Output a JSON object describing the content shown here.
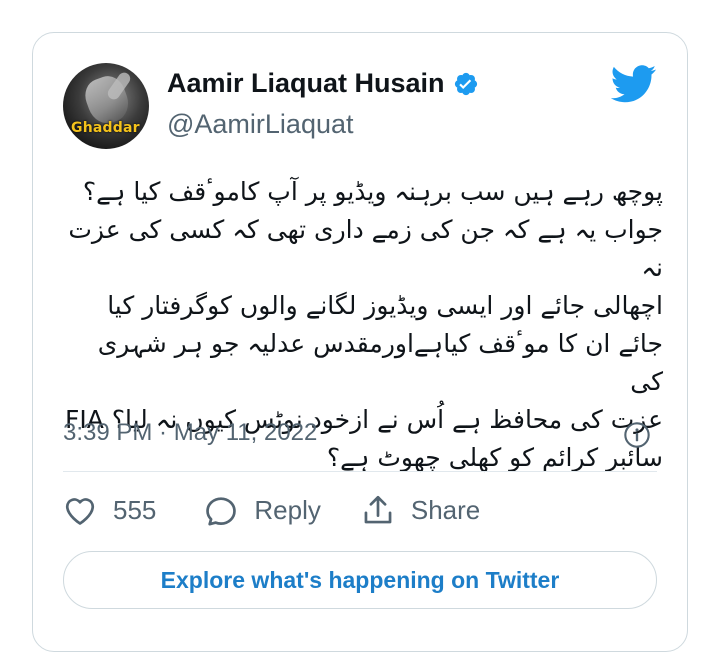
{
  "author": {
    "display_name": "Aamir Liaquat Husain",
    "handle": "@AamirLiaquat",
    "avatar_text": "Ghaddar",
    "verified": true
  },
  "tweet": {
    "text": "پوچھ رہے ہیں سب برہنہ ویڈیو پر آپ کاموٴقف کیا ہے؟\nجواب یہ ہے کہ جن کی زمے داری تھی کہ کسی کی عزت نہ\nاچھالی جائے اور ایسی ویڈیوز لگانے والوں کوگرفتار کیا\nجائے ان کا موٴقف کیاہےاورمقدس عدلیہ جو ہر شہری کی\nعزت کی محافظ ہے اُس نے ازخود نوٹس کیوں نہ لیا؟ FIA\nسائبر کرائم کو کھلی چھوٹ ہے؟",
    "timestamp": "3:39 PM · May 11, 2022"
  },
  "actions": {
    "like_count": "555",
    "reply_label": "Reply",
    "share_label": "Share"
  },
  "explore_label": "Explore what's happening on Twitter",
  "colors": {
    "brand_blue": "#1d9bf0",
    "link_blue": "#1d7ec8",
    "secondary_text": "#536471",
    "border": "#cfd9de"
  },
  "icons": {
    "verified": "verified-badge-icon",
    "twitter": "twitter-bird-icon",
    "info": "info-icon",
    "like": "heart-icon",
    "reply": "speech-bubble-icon",
    "share": "share-upload-icon"
  }
}
